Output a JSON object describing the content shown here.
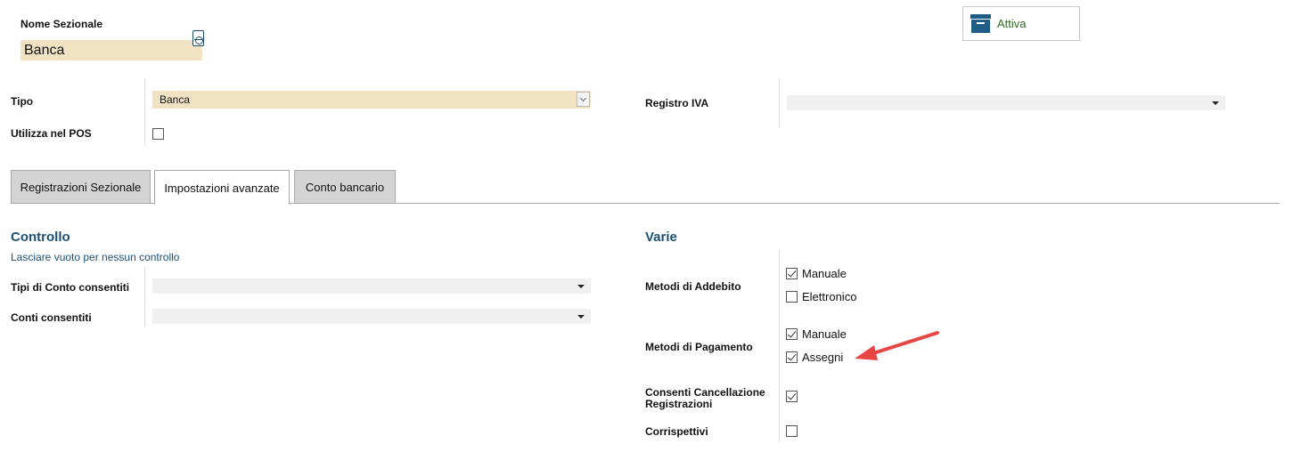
{
  "header": {
    "name_label": "Nome Sezionale",
    "name_value": "Banca",
    "status_label": "Attiva"
  },
  "fields": {
    "tipo_label": "Tipo",
    "tipo_value": "Banca",
    "registro_iva_label": "Registro IVA",
    "registro_iva_value": "",
    "utilizza_pos_label": "Utilizza nel POS",
    "utilizza_pos_checked": false
  },
  "tabs": [
    {
      "label": "Registrazioni Sezionale",
      "active": false
    },
    {
      "label": "Impostazioni avanzate",
      "active": true
    },
    {
      "label": "Conto bancario",
      "active": false
    }
  ],
  "controllo": {
    "title": "Controllo",
    "hint": "Lasciare vuoto per nessun controllo",
    "tipi_conto_label": "Tipi di Conto consentiti",
    "tipi_conto_value": "",
    "conti_label": "Conti consentiti",
    "conti_value": ""
  },
  "varie": {
    "title": "Varie",
    "addebito_label": "Metodi di Addebito",
    "addebito_options": [
      {
        "label": "Manuale",
        "checked": true
      },
      {
        "label": "Elettronico",
        "checked": false
      }
    ],
    "pagamento_label": "Metodi di Pagamento",
    "pagamento_options": [
      {
        "label": "Manuale",
        "checked": true
      },
      {
        "label": "Assegni",
        "checked": true
      }
    ],
    "cancellazione_label_1": "Consenti Cancellazione",
    "cancellazione_label_2": "Registrazioni",
    "cancellazione_checked": true,
    "corrispettivi_label": "Corrispettivi",
    "corrispettivi_checked": false
  },
  "colors": {
    "highlight_field": "#f0e2c2",
    "section_title": "#1d4f74",
    "status_text": "#2e6b1e",
    "annotation_arrow": "#e84545"
  },
  "icons": {
    "status": "archive-icon",
    "translation": "language-icon",
    "annotation": "red-arrow-icon"
  }
}
